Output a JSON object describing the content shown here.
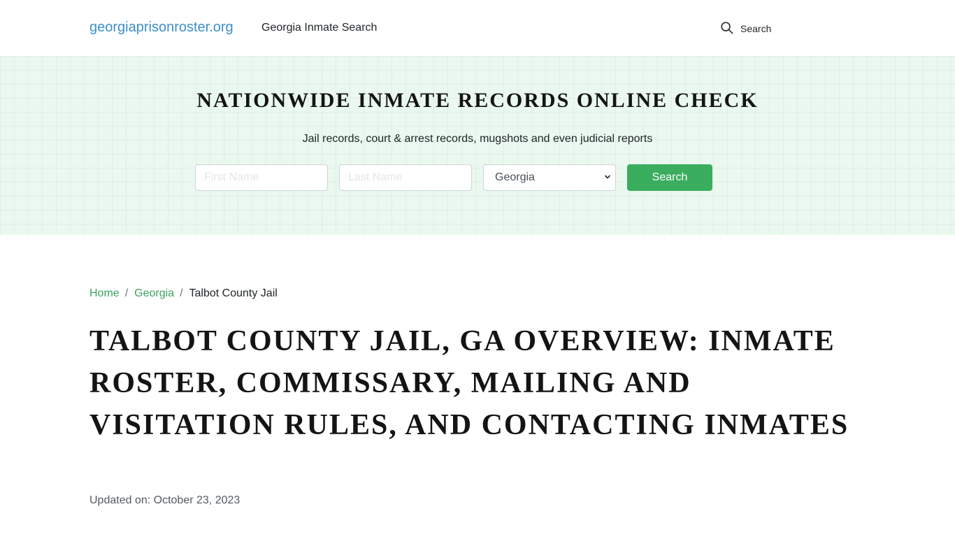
{
  "header": {
    "brand": "georgiaprisonroster.org",
    "nav_link": "Georgia Inmate Search",
    "search_label": "Search",
    "search_icon": "search-icon"
  },
  "hero": {
    "title": "NATIONWIDE INMATE RECORDS ONLINE CHECK",
    "subtitle": "Jail records, court & arrest records, mugshots and even judicial reports",
    "first_name_placeholder": "First Name",
    "first_name_value": "",
    "last_name_placeholder": "Last Name",
    "last_name_value": "",
    "state_selected": "Georgia",
    "search_button": "Search",
    "colors": {
      "background": "#eaf8ef",
      "button": "#3aad5e"
    }
  },
  "breadcrumb": {
    "items": [
      {
        "label": "Home",
        "link": true
      },
      {
        "label": "Georgia",
        "link": true
      },
      {
        "label": "Talbot County Jail",
        "link": false
      }
    ],
    "separator": "/"
  },
  "article": {
    "title": "Talbot County Jail, GA Overview: Inmate Roster, Commissary, Mailing and Visitation Rules, and Contacting Inmates",
    "updated_label": "Updated on:",
    "updated_date": "October 23, 2023"
  },
  "colors": {
    "brand": "#3d8fc9",
    "link_green": "#3aa35f",
    "text": "#212529"
  }
}
